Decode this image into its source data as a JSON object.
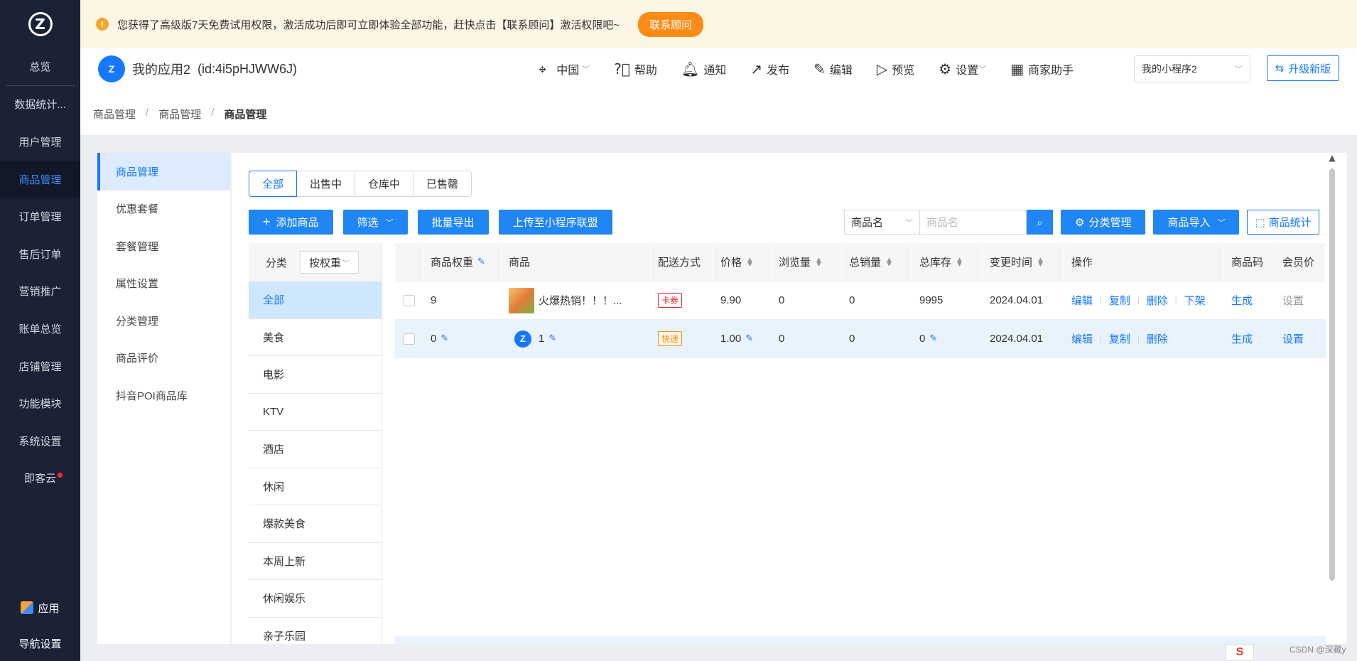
{
  "leftnav": {
    "items": [
      {
        "label": "总览"
      },
      {
        "label": "数据统计..."
      },
      {
        "label": "用户管理"
      },
      {
        "label": "商品管理"
      },
      {
        "label": "订单管理"
      },
      {
        "label": "售后订单"
      },
      {
        "label": "营销推广"
      },
      {
        "label": "账单总览"
      },
      {
        "label": "店铺管理"
      },
      {
        "label": "功能模块"
      },
      {
        "label": "系统设置"
      },
      {
        "label": "即客云"
      }
    ],
    "bottom": {
      "app_label": "应用",
      "nav_settings_label": "导航设置"
    }
  },
  "notice": {
    "text": "您获得了高级版7天免费试用权限，激活成功后即可立即体验全部功能，赶快点击【联系顾问】激活权限吧~",
    "button": "联系顾问"
  },
  "header": {
    "app_name": "我的应用2",
    "app_id": "(id:4i5pHJWW6J)",
    "region": "中国",
    "help": "帮助",
    "notify": "通知",
    "publish": "发布",
    "edit": "编辑",
    "preview": "预览",
    "settings": "设置",
    "merchant_helper": "商家助手",
    "miniapp_select": "我的小程序2",
    "upgrade": "升级新版"
  },
  "breadcrumb": [
    "商品管理",
    "商品管理",
    "商品管理"
  ],
  "subnav": {
    "items": [
      {
        "label": "商品管理"
      },
      {
        "label": "优惠套餐"
      },
      {
        "label": "套餐管理"
      },
      {
        "label": "属性设置"
      },
      {
        "label": "分类管理"
      },
      {
        "label": "商品评价"
      },
      {
        "label": "抖音POI商品库"
      }
    ]
  },
  "tabs": [
    "全部",
    "出售中",
    "仓库中",
    "已售罄"
  ],
  "actions": {
    "add": "添加商品",
    "filter": "筛选",
    "export": "批量导出",
    "upload": "上传至小程序联盟",
    "search_type": "商品名",
    "search_placeholder": "商品名",
    "category_manage": "分类管理",
    "import": "商品导入",
    "stats": "商品统计"
  },
  "categories": {
    "head": "分类",
    "sort": "按权重",
    "items": [
      "全部",
      "美食",
      "电影",
      "KTV",
      "酒店",
      "休闲",
      "爆款美食",
      "本周上新",
      "休闲娱乐",
      "亲子乐园"
    ]
  },
  "table": {
    "headers": [
      "商品权重",
      "商品",
      "配送方式",
      "价格",
      "浏览量",
      "总销量",
      "总库存",
      "变更时间",
      "操作",
      "商品码",
      "会员价"
    ],
    "rows": [
      {
        "weight": "9",
        "name": "火爆热销！！！...",
        "delivery": "卡券",
        "price": "9.90",
        "views": "0",
        "sales": "0",
        "stock": "9995",
        "time": "2024.04.01",
        "ops": [
          "编辑",
          "复制",
          "删除",
          "下架"
        ],
        "code": "生成",
        "member": "设置"
      },
      {
        "weight": "0",
        "name": "1",
        "delivery": "快递",
        "price": "1.00",
        "views": "0",
        "sales": "0",
        "stock": "0",
        "time": "2024.04.01",
        "ops": [
          "编辑",
          "复制",
          "删除"
        ],
        "code": "生成",
        "member": "设置"
      }
    ]
  },
  "watermark": "CSDN @深藏y",
  "csdn_badge": "S"
}
